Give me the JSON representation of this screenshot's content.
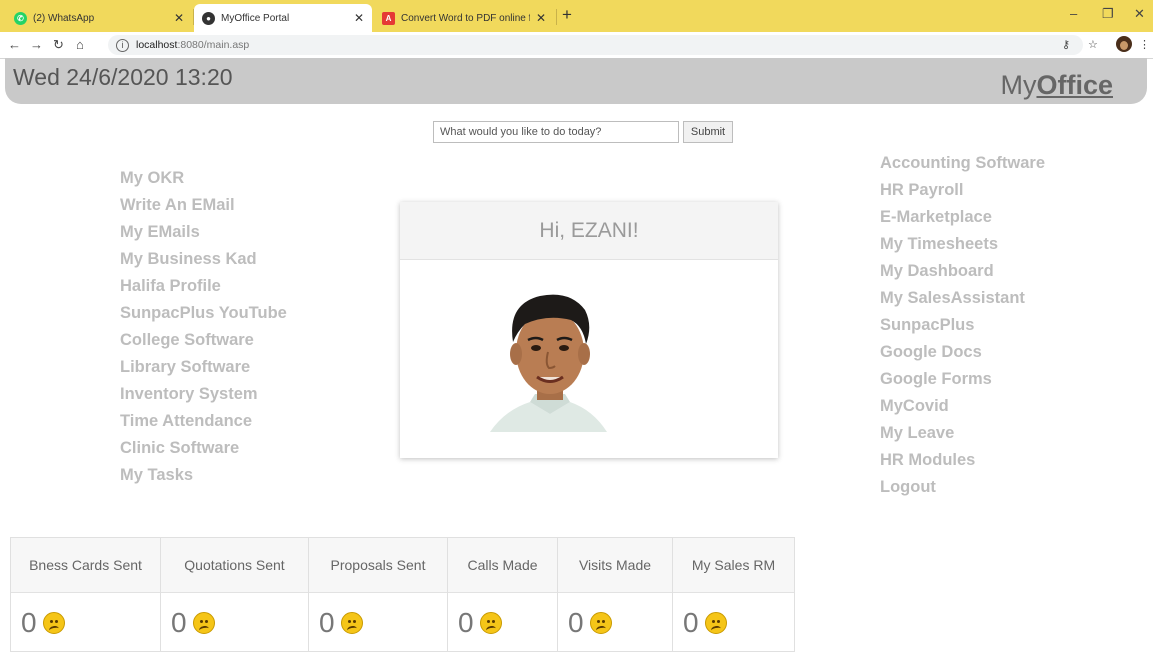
{
  "browser": {
    "tabs": [
      {
        "title": "(2) WhatsApp",
        "favicon_color": "#25d366"
      },
      {
        "title": "MyOffice Portal",
        "favicon_color": "#333333"
      },
      {
        "title": "Convert Word to PDF online for f",
        "favicon_color": "#e53935"
      }
    ],
    "new_tab_label": "+",
    "url_host": "localhost",
    "url_path": ":8080/main.asp",
    "window_controls": {
      "minimize": "–",
      "restore": "❐",
      "close": "✕"
    }
  },
  "header": {
    "datetime": "Wed 24/6/2020 13:20",
    "brand_prefix": "My",
    "brand_bold": "Office"
  },
  "search": {
    "placeholder": "What would you like to do today?",
    "value": "",
    "submit_label": "Submit"
  },
  "left_menu": [
    "My OKR",
    "Write An EMail",
    "My EMails",
    "My Business Kad",
    "Halifa Profile",
    "SunpacPlus YouTube",
    "College Software",
    "Library Software",
    "Inventory System",
    "Time Attendance",
    "Clinic Software",
    "My Tasks"
  ],
  "right_menu": [
    "Accounting Software",
    "HR Payroll",
    "E-Marketplace",
    "My Timesheets",
    "My Dashboard",
    "My SalesAssistant",
    "SunpacPlus",
    "Google Docs",
    "Google Forms",
    "MyCovid",
    "My Leave",
    "HR Modules",
    "Logout"
  ],
  "greeting": {
    "text": "Hi, EZANI!"
  },
  "stats": [
    {
      "label": "Bness Cards Sent",
      "value": "0"
    },
    {
      "label": "Quotations Sent",
      "value": "0"
    },
    {
      "label": "Proposals Sent",
      "value": "0"
    },
    {
      "label": "Calls Made",
      "value": "0"
    },
    {
      "label": "Visits Made",
      "value": "0"
    },
    {
      "label": "My Sales RM",
      "value": "0"
    }
  ],
  "colors": {
    "tab_bar": "#f1d95c",
    "header_bg": "#c9c9c9",
    "menu_text": "#bdbdbd",
    "emoji": "#f5c518"
  }
}
